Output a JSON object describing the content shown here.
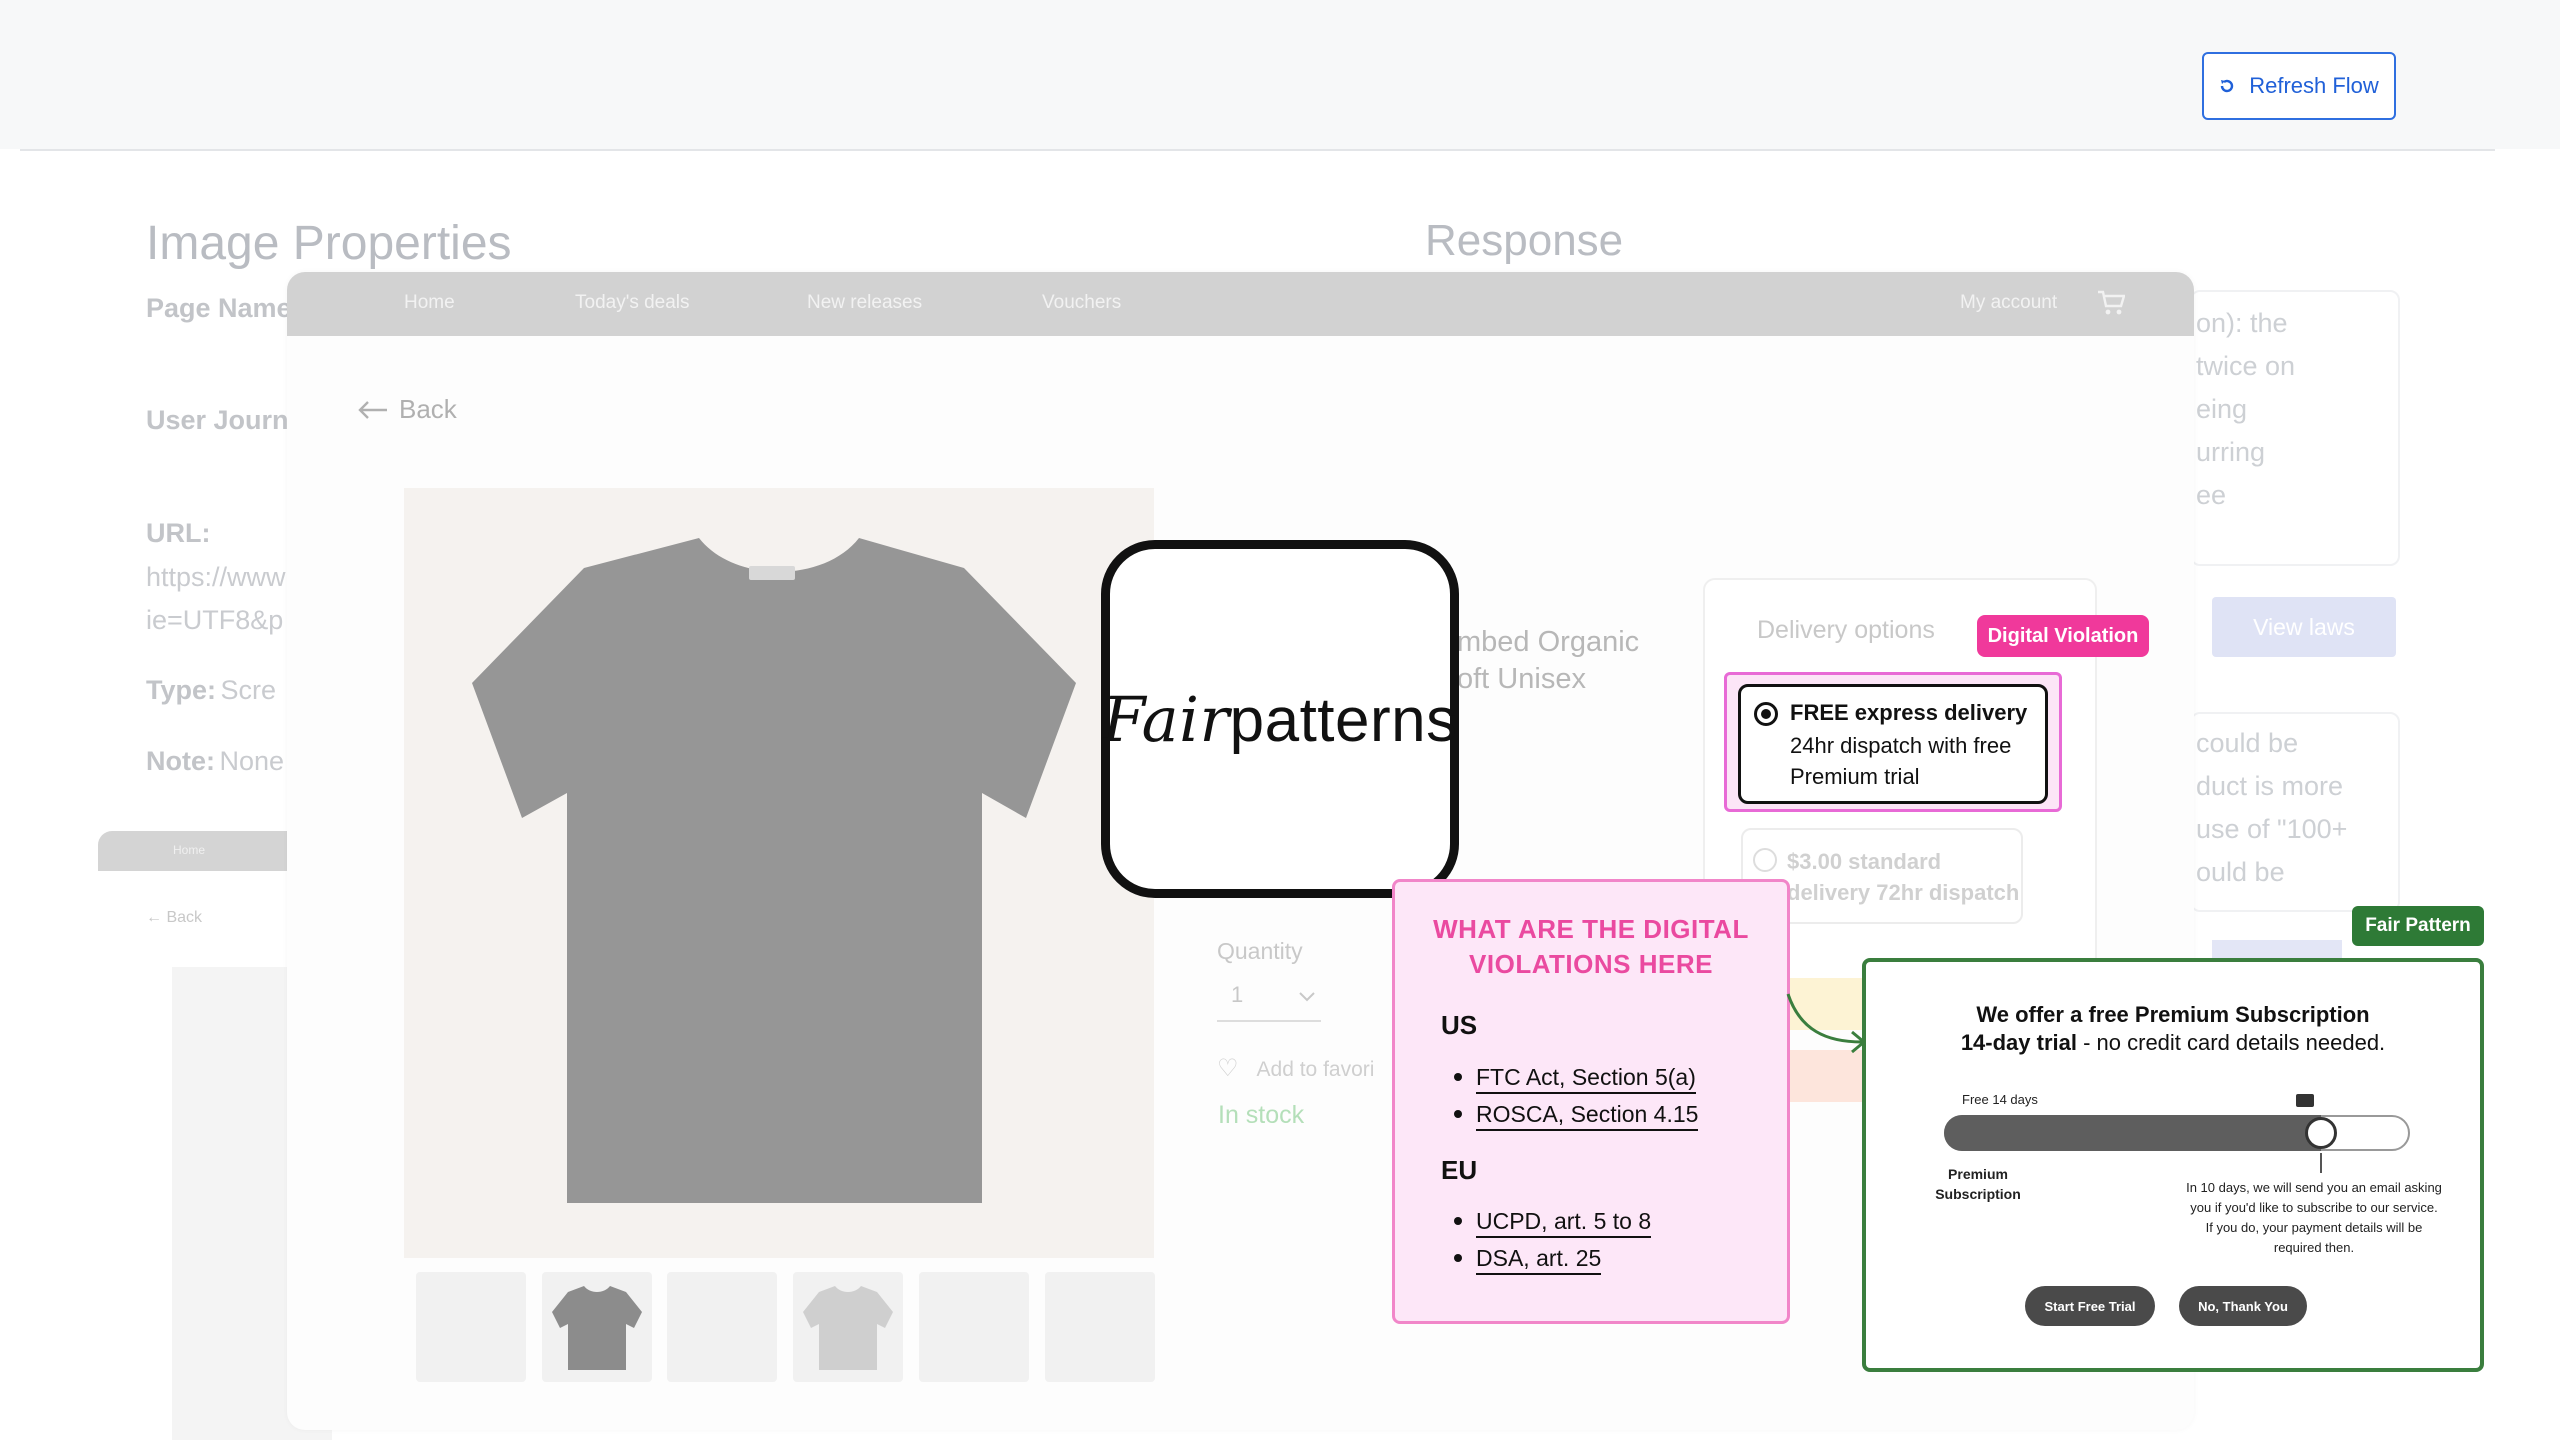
{
  "toolbar": {
    "refresh_label": "Refresh Flow"
  },
  "background": {
    "image_properties_title": "Image Properties",
    "response_title": "Response",
    "page_name_label": "Page Name",
    "user_journey_label": "User Journ",
    "url_label": "URL:",
    "url_line1": "https://www",
    "url_line2": "ie=UTF8&p",
    "type_label": "Type:",
    "type_value": "Scre",
    "note_label": "Note:",
    "note_value": "None",
    "response_lines_1": [
      "on): the",
      "twice on",
      "eing",
      "urring",
      "ee"
    ],
    "response_lines_2": [
      "could be",
      "duct is more",
      "use of \"100+",
      "ould be"
    ],
    "view_laws_label": "View laws",
    "mini_nav_home": "Home",
    "mini_back": "Back"
  },
  "store": {
    "nav": [
      "Home",
      "Today's deals",
      "New releases",
      "Vouchers"
    ],
    "account": "My account",
    "back": "Back",
    "product_title_1": "mbed Organic",
    "product_title_2": "oft Unisex",
    "quantity_label": "Quantity",
    "quantity_value": "1",
    "favorite_label": "Add to favori",
    "stock": "In stock",
    "delivery_label": "Delivery options",
    "standard_line1": "$3.00 standard",
    "standard_line2": "delivery 72hr dispatch"
  },
  "logo": {
    "part1": "Fair",
    "part2": "patterns"
  },
  "digital_violation": {
    "badge": "Digital Violation",
    "option_title": "FREE express delivery",
    "option_sub": "24hr dispatch with free Premium trial"
  },
  "violations": {
    "heading_1": "WHAT ARE THE DIGITAL",
    "heading_2": "VIOLATIONS HERE",
    "regions": [
      {
        "name": "US",
        "items": [
          "FTC Act, Section 5(a)",
          "ROSCA, Section 4.15"
        ]
      },
      {
        "name": "EU",
        "items": [
          "UCPD, art. 5 to 8",
          "DSA, art. 25"
        ]
      }
    ]
  },
  "fair_pattern": {
    "badge": "Fair Pattern",
    "line1": "We offer a free Premium Subscription",
    "line2_bold": "14-day trial",
    "line2_rest": " - no credit card details needed.",
    "free_label": "Free 14 days",
    "slider_progress": 0.81,
    "premium_label": "Premium Subscription",
    "note": "In 10 days, we will send you an email asking you if you'd like to subscribe to our service. If you do, your payment details will be required then.",
    "start_button": "Start Free Trial",
    "no_button": "No, Thank You"
  },
  "colors": {
    "accent_blue": "#2060d8",
    "violation_pink": "#f0399b",
    "fair_green": "#2e7a36"
  }
}
